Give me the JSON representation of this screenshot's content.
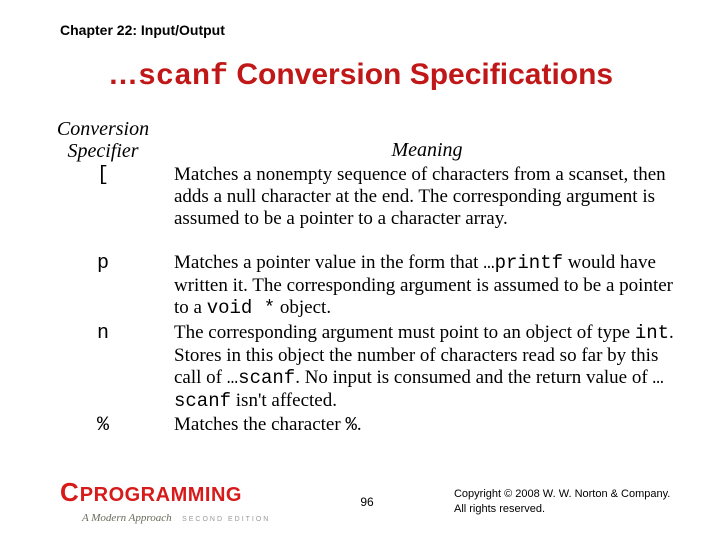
{
  "chapter": "Chapter 22: Input/Output",
  "title_prefix": "…",
  "title_mono": "scanf",
  "title_rest": " Conversion Specifications",
  "headers": {
    "specifier": "Conversion Specifier",
    "meaning": "Meaning"
  },
  "rows": {
    "bracket": {
      "spec": "[",
      "mean_a": "Matches a nonempty sequence of characters from a scanset, then adds a null character at the end. The corresponding argument is assumed to be a pointer to a character array."
    },
    "p": {
      "spec": "p",
      "mean_a": "Matches a pointer value in the form that ",
      "mean_mono1": "…printf",
      "mean_b": " would have written it. The corresponding argument is assumed to be a pointer to a ",
      "mean_mono2": "void *",
      "mean_c": " object."
    },
    "n": {
      "spec": "n",
      "mean_a": "The corresponding argument must point to an object of type ",
      "mean_mono1": "int",
      "mean_b": ". Stores in this object the number of characters read so far by this call of ",
      "mean_mono2": "…scanf",
      "mean_c": ". No input is consumed and the return value of ",
      "mean_mono3": "…scanf",
      "mean_d": " isn't affected."
    },
    "pct": {
      "spec": "%",
      "mean_a": "Matches the character ",
      "mean_mono1": "%",
      "mean_b": "."
    }
  },
  "logo": {
    "c": "C",
    "prog": "PROGRAMMING",
    "sub": "A Modern Approach",
    "ed": "SECOND EDITION"
  },
  "pagenum": "96",
  "copyright_line1": "Copyright © 2008 W. W. Norton & Company.",
  "copyright_line2": "All rights reserved."
}
